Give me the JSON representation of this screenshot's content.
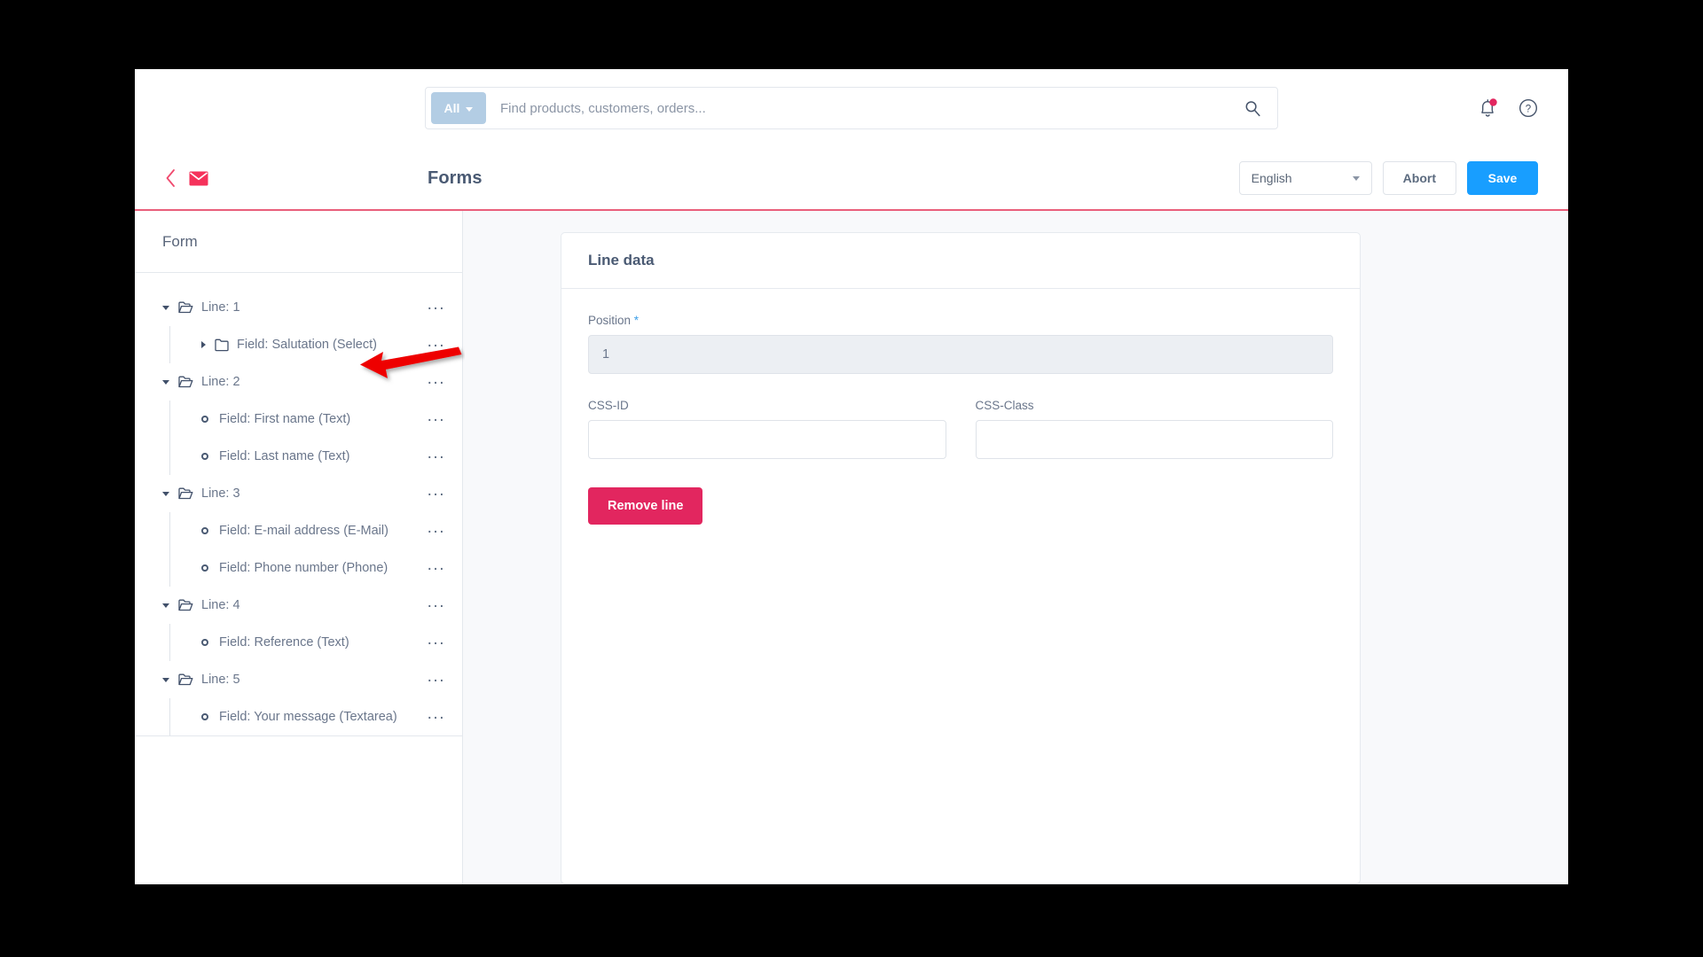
{
  "search": {
    "scope_label": "All",
    "placeholder": "Find products, customers, orders...",
    "value": "",
    "search_icon": "magnifier-icon"
  },
  "topbar": {
    "notifications_icon": "bell-icon",
    "help_icon": "question-circle-icon",
    "has_notification": true
  },
  "toolbar": {
    "back_icon": "chevron-left-icon",
    "mail_icon": "envelope-icon",
    "title": "Forms",
    "language": "English",
    "abort_label": "Abort",
    "save_label": "Save"
  },
  "sidebar": {
    "header": "Form",
    "tree": [
      {
        "label": "Line: 1",
        "level": 0,
        "icon": "folder-open-icon",
        "expanded": true,
        "menu": "..."
      },
      {
        "label": "Field: Salutation (Select)",
        "level": 1,
        "icon": "folder-closed-icon",
        "expanded": false,
        "menu": "..."
      },
      {
        "label": "Line: 2",
        "level": 0,
        "icon": "folder-open-icon",
        "expanded": true,
        "menu": "..."
      },
      {
        "label": "Field: First name (Text)",
        "level": 1,
        "icon": "circle-bullet-icon",
        "menu": "..."
      },
      {
        "label": "Field: Last name (Text)",
        "level": 1,
        "icon": "circle-bullet-icon",
        "menu": "..."
      },
      {
        "label": "Line: 3",
        "level": 0,
        "icon": "folder-open-icon",
        "expanded": true,
        "menu": "..."
      },
      {
        "label": "Field: E-mail address (E-Mail)",
        "level": 1,
        "icon": "circle-bullet-icon",
        "menu": "..."
      },
      {
        "label": "Field: Phone number (Phone)",
        "level": 1,
        "icon": "circle-bullet-icon",
        "menu": "..."
      },
      {
        "label": "Line: 4",
        "level": 0,
        "icon": "folder-open-icon",
        "expanded": true,
        "menu": "..."
      },
      {
        "label": "Field: Reference (Text)",
        "level": 1,
        "icon": "circle-bullet-icon",
        "menu": "..."
      },
      {
        "label": "Line: 5",
        "level": 0,
        "icon": "folder-open-icon",
        "expanded": true,
        "menu": "..."
      },
      {
        "label": "Field: Your message (Textarea)",
        "level": 1,
        "icon": "circle-bullet-icon",
        "menu": "..."
      }
    ]
  },
  "card": {
    "title": "Line data",
    "position_label": "Position",
    "position_required_marker": "*",
    "position_value": "1",
    "cssid_label": "CSS-ID",
    "cssid_value": "",
    "cssclass_label": "CSS-Class",
    "cssclass_value": "",
    "remove_label": "Remove line"
  },
  "colors": {
    "accent_red": "#e2265f",
    "accent_blue": "#189eff",
    "toolbar_rule": "#e95f7b",
    "text_primary": "#4a5a73",
    "text_muted": "#6a768b",
    "page_bg": "#f8f9fb",
    "annotation_arrow": "#ee0000"
  }
}
